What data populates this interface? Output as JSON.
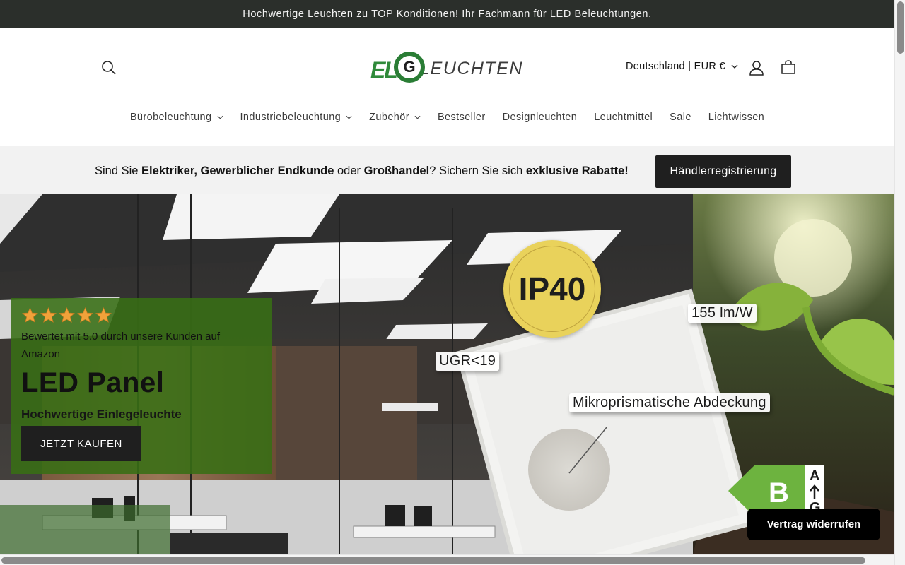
{
  "announcement": {
    "text": "Hochwertige Leuchten zu TOP Konditionen! Ihr Fachmann für LED Beleuchtungen."
  },
  "header": {
    "logo_mark": "EL",
    "logo_g": "G",
    "logo_text": "LEUCHTEN",
    "country_selector": "Deutschland | EUR €",
    "icons": {
      "search": "search-icon",
      "account": "user-icon",
      "cart": "cart-icon"
    }
  },
  "nav": {
    "items": [
      {
        "label": "Bürobeleuchtung",
        "has_dropdown": true
      },
      {
        "label": "Industriebeleuchtung",
        "has_dropdown": true
      },
      {
        "label": "Zubehör",
        "has_dropdown": true
      },
      {
        "label": "Bestseller",
        "has_dropdown": false
      },
      {
        "label": "Designleuchten",
        "has_dropdown": false
      },
      {
        "label": "Leuchtmittel",
        "has_dropdown": false
      },
      {
        "label": "Sale",
        "has_dropdown": false
      },
      {
        "label": "Lichtwissen",
        "has_dropdown": false
      }
    ]
  },
  "promo_bar": {
    "text_1": "Sind Sie ",
    "bold_1": "Elektriker, Gewerblicher Endkunde",
    "text_2": " oder ",
    "bold_2": "Großhandel",
    "text_3": "? Sichern Sie sich ",
    "bold_3": "exklusive Rabatte!",
    "button": "Händlerregistrierung"
  },
  "hero": {
    "rating_stars": 5,
    "rating_text": "Bewertet mit 5.0 durch unsere Kunden auf Amazon",
    "title": "LED Panel",
    "subtitle": "Hochwertige Einlegeleuchte",
    "cta": "JETZT KAUFEN",
    "badges": {
      "ip": "IP40",
      "efficacy": "155 lm/W",
      "ugr": "UGR<19",
      "cover": "Mikroprismatische Abdeckung",
      "energy_class": "B",
      "energy_scale_top": "A",
      "energy_scale_bottom": "G"
    }
  },
  "consent": {
    "revoke_button": "Vertrag widerrufen"
  },
  "colors": {
    "announcement_bg": "#2b2f2b",
    "brand_green": "#2a7d35",
    "card_green": "#386e14",
    "star": "#f0a23a",
    "ip_yellow": "#e9d25b"
  }
}
